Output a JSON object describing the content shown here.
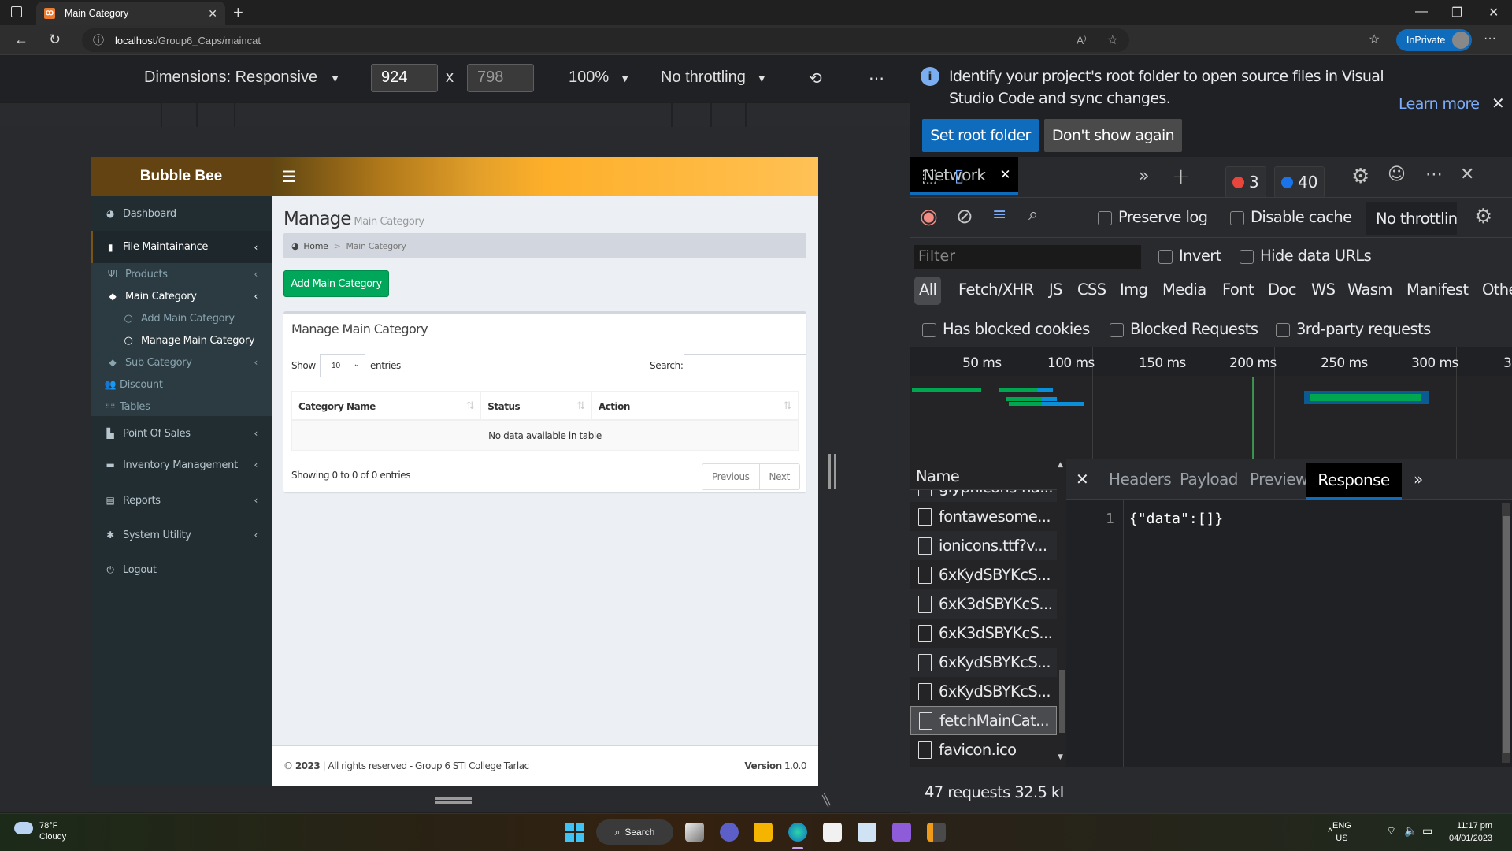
{
  "browser": {
    "tab_title": "Main Category",
    "address_host": "localhost",
    "address_path": "/Group6_Caps/maincat",
    "inprivate_label": "InPrivate"
  },
  "device_toolbar": {
    "dimensions_label": "Dimensions: Responsive",
    "width": "924",
    "height": "798",
    "zoom": "100%",
    "throttling": "No throttling",
    "times": "x"
  },
  "app": {
    "brand": "Bubble Bee",
    "colors": {
      "brand": "#634311",
      "accent": "#fdaf2a",
      "success": "#00a65a",
      "sidebar": "#222d32"
    },
    "sidebar": {
      "dashboard": "Dashboard",
      "file_maintenance": "File Maintainance",
      "products": "Products",
      "main_category": "Main Category",
      "add_main_category": "Add Main Category",
      "manage_main_category": "Manage Main Category",
      "sub_category": "Sub Category",
      "discount": "Discount",
      "tables": "Tables",
      "point_of_sales": "Point Of Sales",
      "inventory_management": "Inventory Management",
      "reports": "Reports",
      "system_utility": "System Utility",
      "logout": "Logout"
    },
    "page_title": "Manage",
    "page_subtitle": "Main Category",
    "breadcrumb": {
      "home": "Home",
      "sep": ">",
      "current": "Main Category"
    },
    "add_button": "Add Main Category",
    "box_title": "Manage Main Category",
    "show_label": "Show",
    "entries_label": "entries",
    "page_length": "10",
    "search_label": "Search:",
    "search_value": "",
    "table": {
      "columns": [
        "Category Name",
        "Status",
        "Action"
      ],
      "rows": [],
      "empty_message": "No data available in table"
    },
    "info": "Showing 0 to 0 of 0 entries",
    "pager": {
      "previous": "Previous",
      "next": "Next"
    },
    "footer": {
      "copy": "©",
      "year": "2023",
      "rights": "| All rights reserved - Group 6 STI College Tarlac",
      "version_label": "Version",
      "version": "1.0.0"
    }
  },
  "devtools": {
    "infobar": {
      "message": "Identify your project's root folder to open source files in Visual Studio Code and sync changes.",
      "learn_more": "Learn more",
      "set_root": "Set root folder",
      "dont_show": "Don't show again"
    },
    "active_tab": "Network",
    "errors": "3",
    "messages": "40",
    "toolbar": {
      "preserve_log": "Preserve log",
      "disable_cache": "Disable cache",
      "throttling": "No throttlin"
    },
    "filter_placeholder": "Filter",
    "invert": "Invert",
    "hide_data_urls": "Hide data URLs",
    "types": [
      "All",
      "Fetch/XHR",
      "JS",
      "CSS",
      "Img",
      "Media",
      "Font",
      "Doc",
      "WS",
      "Wasm",
      "Manifest",
      "Othe"
    ],
    "blocked_cookies": "Has blocked cookies",
    "blocked_requests": "Blocked Requests",
    "third_party": "3rd-party requests",
    "timeline_ticks": [
      "50 ms",
      "100 ms",
      "150 ms",
      "200 ms",
      "250 ms",
      "300 ms",
      "3"
    ],
    "name_header": "Name",
    "requests": [
      "glyphicons-ha...",
      "fontawesome...",
      "ionicons.ttf?v...",
      "6xKydSBYKcS...",
      "6xK3dSBYKcS...",
      "6xK3dSBYKcS...",
      "6xKydSBYKcS...",
      "6xKydSBYKcS...",
      "fetchMainCat...",
      "favicon.ico"
    ],
    "detail_tabs": [
      "Headers",
      "Payload",
      "Preview",
      "Response"
    ],
    "response_line": "1",
    "response_body": "{\"data\":[]}",
    "summary": "47 requests   32.5 kI"
  },
  "taskbar": {
    "temp": "78°F",
    "weather": "Cloudy",
    "search": "Search",
    "lang1": "ENG",
    "lang2": "US",
    "time": "11:17 pm",
    "date": "04/01/2023"
  }
}
